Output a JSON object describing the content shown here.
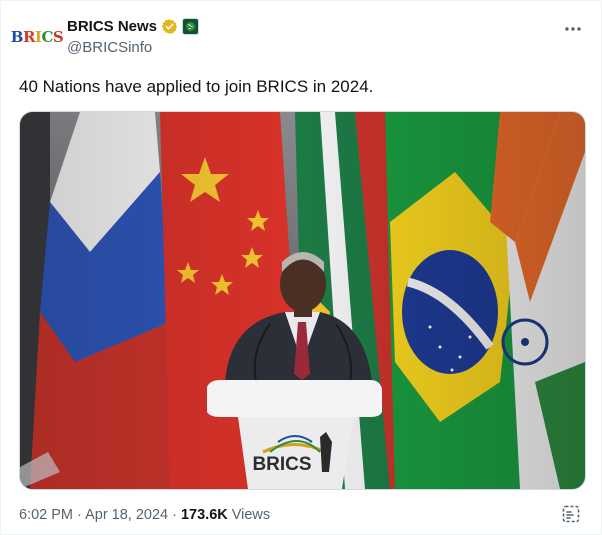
{
  "account": {
    "avatar_text": [
      "B",
      "R",
      "I",
      "C",
      "S"
    ],
    "display_name": "BRICS News",
    "handle": "@BRICSinfo",
    "verified_badge": "gold-check-icon",
    "affiliate_badge": "affiliation-icon"
  },
  "tweet": {
    "text": "40 Nations have applied to join BRICS in 2024.",
    "media": {
      "podium_logo_text": "BRICS"
    },
    "timestamp": "6:02 PM · Apr 18, 2024",
    "separator": "·",
    "views_count": "173.6K",
    "views_label": "Views"
  },
  "icons": {
    "more": "more-horizontal-icon",
    "grok": "grok-icon"
  },
  "colors": {
    "verified_gold": "#e2b719",
    "text_primary": "#0f1419",
    "text_secondary": "#536471"
  }
}
